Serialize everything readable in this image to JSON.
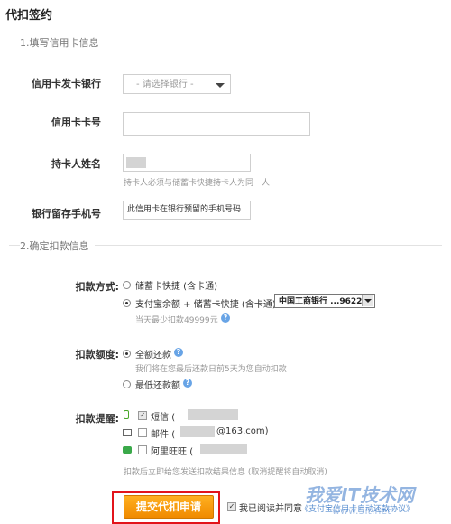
{
  "page": {
    "title": "代扣签约"
  },
  "section1": {
    "title": "1.填写信用卡信息",
    "bank_label": "信用卡发卡银行",
    "bank_select": "- 请选择银行 -",
    "card_no_label": "信用卡卡号",
    "card_no_value": "",
    "holder_label": "持卡人姓名",
    "holder_hint": "持卡人必须与储蓄卡快捷持卡人为同一人",
    "phone_label": "银行留存手机号",
    "phone_placeholder": "此信用卡在银行预留的手机号码"
  },
  "section2": {
    "title": "2.确定扣款信息",
    "method_label": "扣款方式:",
    "method_options": [
      {
        "label": "储蓄卡快捷 (含卡通)",
        "selected": false
      },
      {
        "label": "支付宝余额 + 储蓄卡快捷 (含卡通)",
        "selected": true
      }
    ],
    "card_select": "中国工商银行 ...9622",
    "daily_limit": "当天最少扣款49999元",
    "amount_label": "扣款额度:",
    "amount_options": [
      {
        "label": "全额还款",
        "selected": true
      },
      {
        "label": "最低还款额",
        "selected": false
      }
    ],
    "amount_hint": "我们将在您最后还款日前5天为您自动扣款",
    "reminder_label": "扣款提醒:",
    "reminders": [
      {
        "icon": "phone-icon",
        "label": "短信",
        "open": "(",
        "suffix": "",
        "checked": true
      },
      {
        "icon": "mail-icon",
        "label": "邮件",
        "open": "(",
        "suffix": "@163.com)",
        "checked": false
      },
      {
        "icon": "chat-icon",
        "label": "阿里旺旺",
        "open": "(",
        "suffix": "",
        "checked": false
      }
    ],
    "reminder_hint": "扣款后立即给您发送扣款结果信息 (取消提醒将自动取消)"
  },
  "footer": {
    "submit_label": "提交代扣申请",
    "agree_text": "我已阅读并同意",
    "agreement_link": "《支付宝信用卡自动还款协议》",
    "agree_checked": true
  },
  "watermark": {
    "main": "我爱IT技术网",
    "sub": "www.5it.net"
  },
  "colors": {
    "accent": "#f08a00",
    "highlight_frame": "#e2141b",
    "help": "#68a4e6"
  }
}
